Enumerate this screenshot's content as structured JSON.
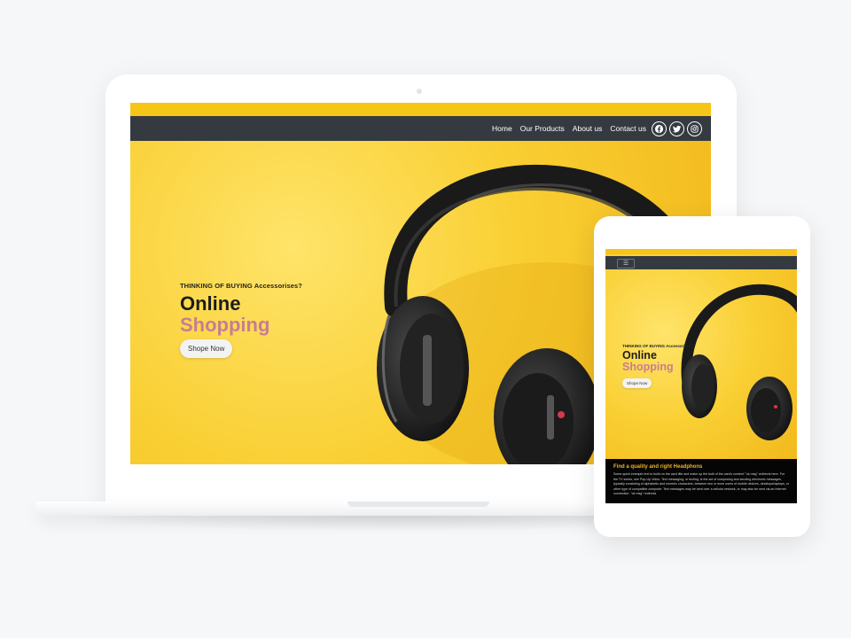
{
  "desktop": {
    "nav": {
      "links": [
        "Home",
        "Our Products",
        "About us",
        "Contact us"
      ],
      "social": [
        "facebook-icon",
        "twitter-icon",
        "instagram-icon"
      ]
    },
    "hero": {
      "kicker": "THINKING OF BUYING Accessorises?",
      "title_line1": "Online",
      "title_line2": "Shopping",
      "cta": "Shope Now"
    }
  },
  "tablet": {
    "nav": {
      "menu_icon": "hamburger-icon"
    },
    "hero": {
      "kicker": "THINKING OF BUYING Accessorises?",
      "title_line1": "Online",
      "title_line2": "Shopping",
      "cta": "Shope Now"
    },
    "section": {
      "title": "Find a quality and right Headphons",
      "body": "Some quick example text to build on the card title and make up the bulk of the card's content.'\"ok msg\" redirects here. For the TV series, see Pop-Up Video. Text messaging, or texting, is the act of composing and sending electronic messages, typically consisting of alphabetic and numeric characters, between two or more users of mobile devices, desktops/laptops, or other type of compatible computer. Text messages may be sent over a cellular network, or may also be sent via an Internet connection. \"ok msg\" redirects"
    }
  },
  "colors": {
    "accent_yellow": "#f7c518",
    "navbar": "#343a40",
    "title_pink": "#c77d93",
    "section_title": "#f2b222"
  }
}
